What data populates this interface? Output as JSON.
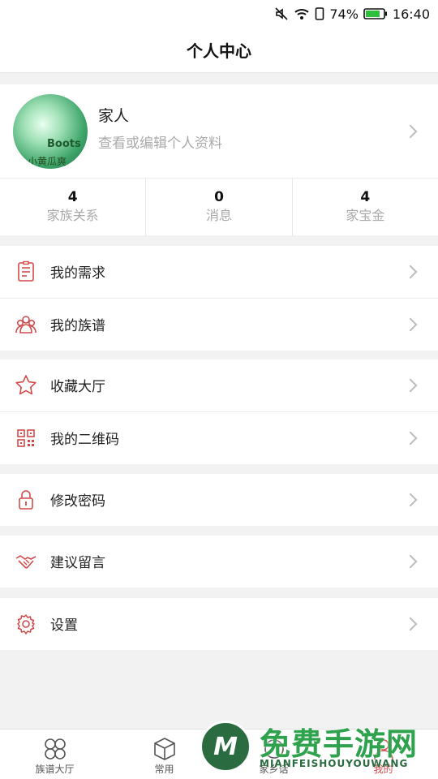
{
  "status": {
    "battery": "74%",
    "time": "16:40"
  },
  "header": {
    "title": "个人中心"
  },
  "profile": {
    "name": "家人",
    "subtitle": "查看或编辑个人资料",
    "avatar_text": "Boots",
    "avatar_text2": "小黄瓜爽"
  },
  "stats": [
    {
      "value": "4",
      "label": "家族关系"
    },
    {
      "value": "0",
      "label": "消息"
    },
    {
      "value": "4",
      "label": "家宝金"
    }
  ],
  "menu": [
    {
      "label": "我的需求",
      "icon": "document-icon"
    },
    {
      "label": "我的族谱",
      "icon": "family-icon"
    },
    {
      "label": "收藏大厅",
      "icon": "star-icon"
    },
    {
      "label": "我的二维码",
      "icon": "qrcode-icon"
    },
    {
      "label": "修改密码",
      "icon": "lock-icon"
    },
    {
      "label": "建议留言",
      "icon": "handshake-icon"
    },
    {
      "label": "设置",
      "icon": "gear-icon"
    }
  ],
  "tabs": [
    {
      "label": "族谱大厅",
      "icon": "clover-icon"
    },
    {
      "label": "常用",
      "icon": "cube-icon"
    },
    {
      "label": "家乡话",
      "icon": "voice-icon"
    },
    {
      "label": "我的",
      "icon": "person-icon"
    }
  ],
  "watermark": {
    "text": "免费手游网",
    "sub": "MIANFEISHOUYOUWANG",
    "logo_letter": "M"
  },
  "colors": {
    "accent": "#d24a4a",
    "muted_text": "#aaaaaa",
    "background": "#f2f2f2"
  }
}
